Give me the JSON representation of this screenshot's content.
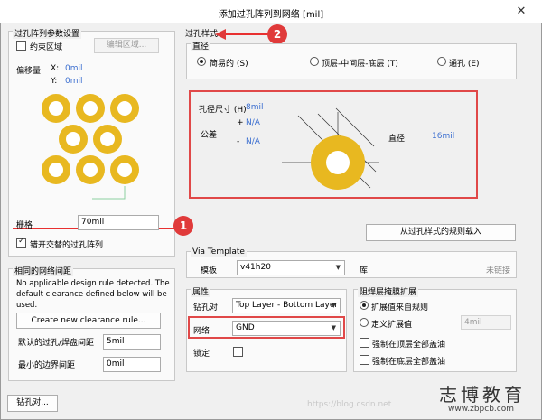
{
  "window": {
    "title": "添加过孔阵列到网络 [mil]"
  },
  "left": {
    "params_group": "过孔阵列参数设置",
    "constrain_region": "约束区域",
    "edit_region_btn": "编辑区域...",
    "offset_label": "偏移量",
    "offset_x_label": "X:",
    "offset_x_value": "0mil",
    "offset_y_label": "Y:",
    "offset_y_value": "0mil",
    "grid_label": "栅格",
    "grid_value": "70mil",
    "stagger_label": "错开交替的过孔阵列",
    "stagger_checked": true,
    "clearance_group": "相同的网络间距",
    "clearance_note": "No applicable design rule detected. The default clearance defined below will be used.",
    "create_rule_btn": "Create new clearance rule...",
    "default_clearance_label": "默认的过孔/焊盘间距",
    "default_clearance_value": "5mil",
    "min_border_label": "最小的边界间距",
    "min_border_value": "0mil"
  },
  "right": {
    "via_style_group": "过孔样式",
    "diameter_label": "直径",
    "radios": [
      "简易的 (S)",
      "顶层-中间层-底层 (T)",
      "通孔 (E)"
    ],
    "hole_size_label": "孔径尺寸 (H)",
    "hole_size_value": "8mil",
    "tolerance_label": "公差",
    "tol_plus": "+",
    "tol_plus_value": "N/A",
    "tol_minus": "-",
    "tol_minus_value": "N/A",
    "diameter_value_label": "直径",
    "diameter_value": "16mil",
    "load_rule_btn": "从过孔样式的规则载入",
    "template_group": "Via Template",
    "template_label": "模板",
    "template_value": "v41h20",
    "library_label": "库",
    "library_status": "未链接",
    "props_group": "属性",
    "drill_pair_label": "钻孔对",
    "drill_pair_value": "Top Layer - Bottom Layer",
    "net_label": "网络",
    "net_value": "GND",
    "lock_label": "锁定",
    "mask_group": "阻焊层掩膜扩展",
    "mask_rule": "扩展值来自规则",
    "mask_specify": "定义扩展值",
    "mask_value": "4mil",
    "force_top": "强制在顶层全部盖油",
    "force_bottom": "强制在底层全部盖油"
  },
  "bottom": {
    "drill_pairs_btn": "钻孔对...",
    "watermark_url": "https://blog.csdn.net",
    "watermark_cn": "志博教育",
    "watermark_site": "www.zbpcb.com"
  },
  "annotations": {
    "marker1": "1",
    "marker2": "2"
  },
  "colors": {
    "via_pad": "#e8b820",
    "hole": "#ffffff",
    "accent_red": "#e03a3a",
    "link_blue": "#3c6fd0"
  },
  "icons": [
    "close-icon",
    "dropdown-arrow-icon",
    "check-icon",
    "radio-icon"
  ]
}
